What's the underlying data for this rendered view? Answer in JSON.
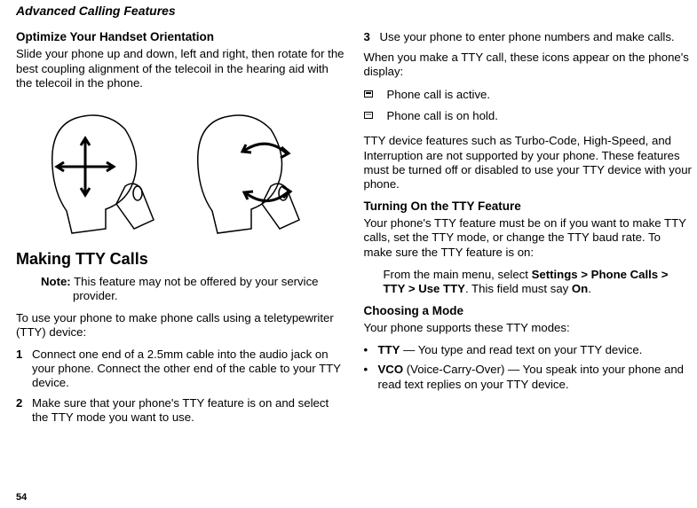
{
  "page_number": "54",
  "header": "Advanced Calling Features",
  "left": {
    "subhead1": "Optimize Your Handset Orientation",
    "p1": "Slide your phone up and down, left and right, then rotate for the best coupling alignment of the telecoil in the hearing aid with the telecoil in the phone.",
    "h2": "Making TTY Calls",
    "note_label": "Note:",
    "note_text": " This feature may not be offered by your service provider.",
    "p2": "To use your phone to make phone calls using a teletypewriter (TTY) device:",
    "steps": [
      {
        "num": "1",
        "text": "Connect one end of a 2.5mm cable into the audio jack on your phone. Connect the other end of the cable to your TTY device."
      },
      {
        "num": "2",
        "text": "Make sure that your phone's TTY feature is on and select the TTY mode you want to use."
      }
    ]
  },
  "right": {
    "step3": {
      "num": "3",
      "text": "Use your phone to enter phone numbers and make calls."
    },
    "p1": "When you make a TTY call, these icons appear on the phone's display:",
    "icon_rows": [
      {
        "icon_name": "tty-active-icon",
        "text": "Phone call is active."
      },
      {
        "icon_name": "tty-hold-icon",
        "text": "Phone call is on hold."
      }
    ],
    "p2": "TTY device features such as Turbo-Code, High-Speed, and Interruption are not supported by your phone. These features must be turned off or disabled to use your TTY device with your phone.",
    "subhead2": "Turning On the TTY Feature",
    "p3": "Your phone's TTY feature must be on if you want to make TTY calls, set the TTY mode, or change the TTY baud rate. To make sure the TTY feature is on:",
    "menu_pre": "From the main menu, select ",
    "menu_bold": "Settings > Phone Calls > TTY > Use TTY",
    "menu_mid": ". This field must say ",
    "menu_on": "On",
    "menu_post": ".",
    "subhead3": "Choosing a Mode",
    "p4": "Your phone supports these TTY modes:",
    "modes": [
      {
        "bold": "TTY",
        "text": " — You type and read text on your TTY device."
      },
      {
        "bold": "VCO",
        "text": " (Voice-Carry-Over) — You speak into your phone and read text replies on your TTY device."
      }
    ]
  }
}
